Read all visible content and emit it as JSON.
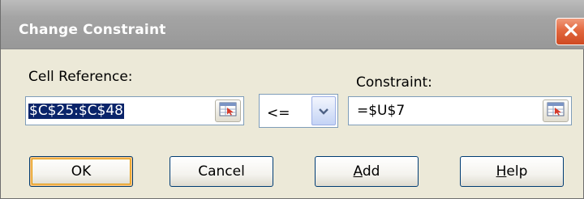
{
  "dialog": {
    "title": "Change Constraint",
    "close_icon": "close-icon"
  },
  "cell_reference": {
    "label": "Cell Reference:",
    "value": "$C$25:$C$48"
  },
  "operator": {
    "value": "<="
  },
  "constraint": {
    "label": "Constraint:",
    "value": "=$U$7"
  },
  "buttons": {
    "ok": "OK",
    "cancel": "Cancel",
    "add_mnemonic": "A",
    "add_rest": "dd",
    "help_mnemonic": "H",
    "help_rest": "elp"
  },
  "colors": {
    "accent": "#e2683f",
    "selection": "#0a246a",
    "dialog_bg": "#ece9d8"
  }
}
